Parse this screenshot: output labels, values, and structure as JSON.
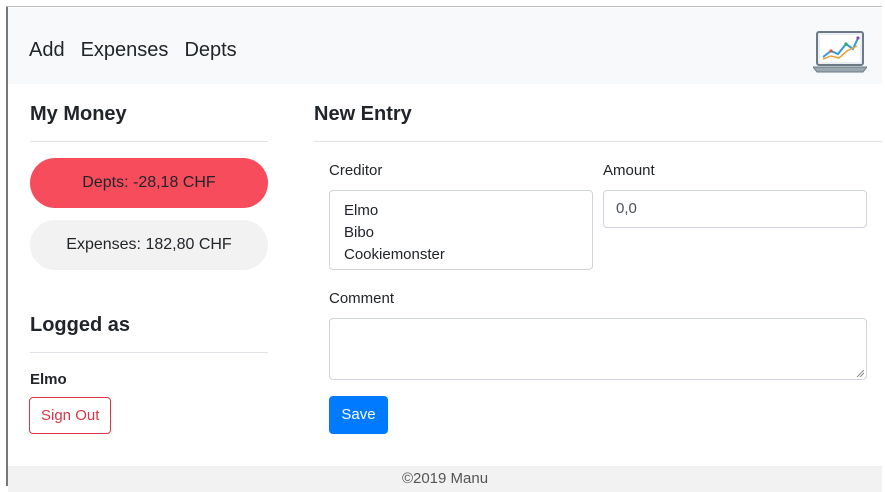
{
  "nav": {
    "items": [
      {
        "label": "Add"
      },
      {
        "label": "Expenses"
      },
      {
        "label": "Depts"
      }
    ],
    "logo_icon": "laptop-chart-icon"
  },
  "sidebar": {
    "title": "My Money",
    "depts_badge": "Depts: -28,18 CHF",
    "expenses_badge": "Expenses: 182,80 CHF",
    "logged_title": "Logged as",
    "user_name": "Elmo",
    "signout_label": "Sign Out"
  },
  "form": {
    "title": "New Entry",
    "creditor_label": "Creditor",
    "creditor_options": [
      "Elmo",
      "Bibo",
      "Cookiemonster"
    ],
    "amount_label": "Amount",
    "amount_value": "0,0",
    "comment_label": "Comment",
    "comment_value": "",
    "save_label": "Save"
  },
  "footer": {
    "text": "©2019 Manu"
  },
  "colors": {
    "primary": "#007bff",
    "danger": "#dc3545",
    "depts_pill": "#f64c5c",
    "expenses_pill": "#f2f2f2"
  }
}
